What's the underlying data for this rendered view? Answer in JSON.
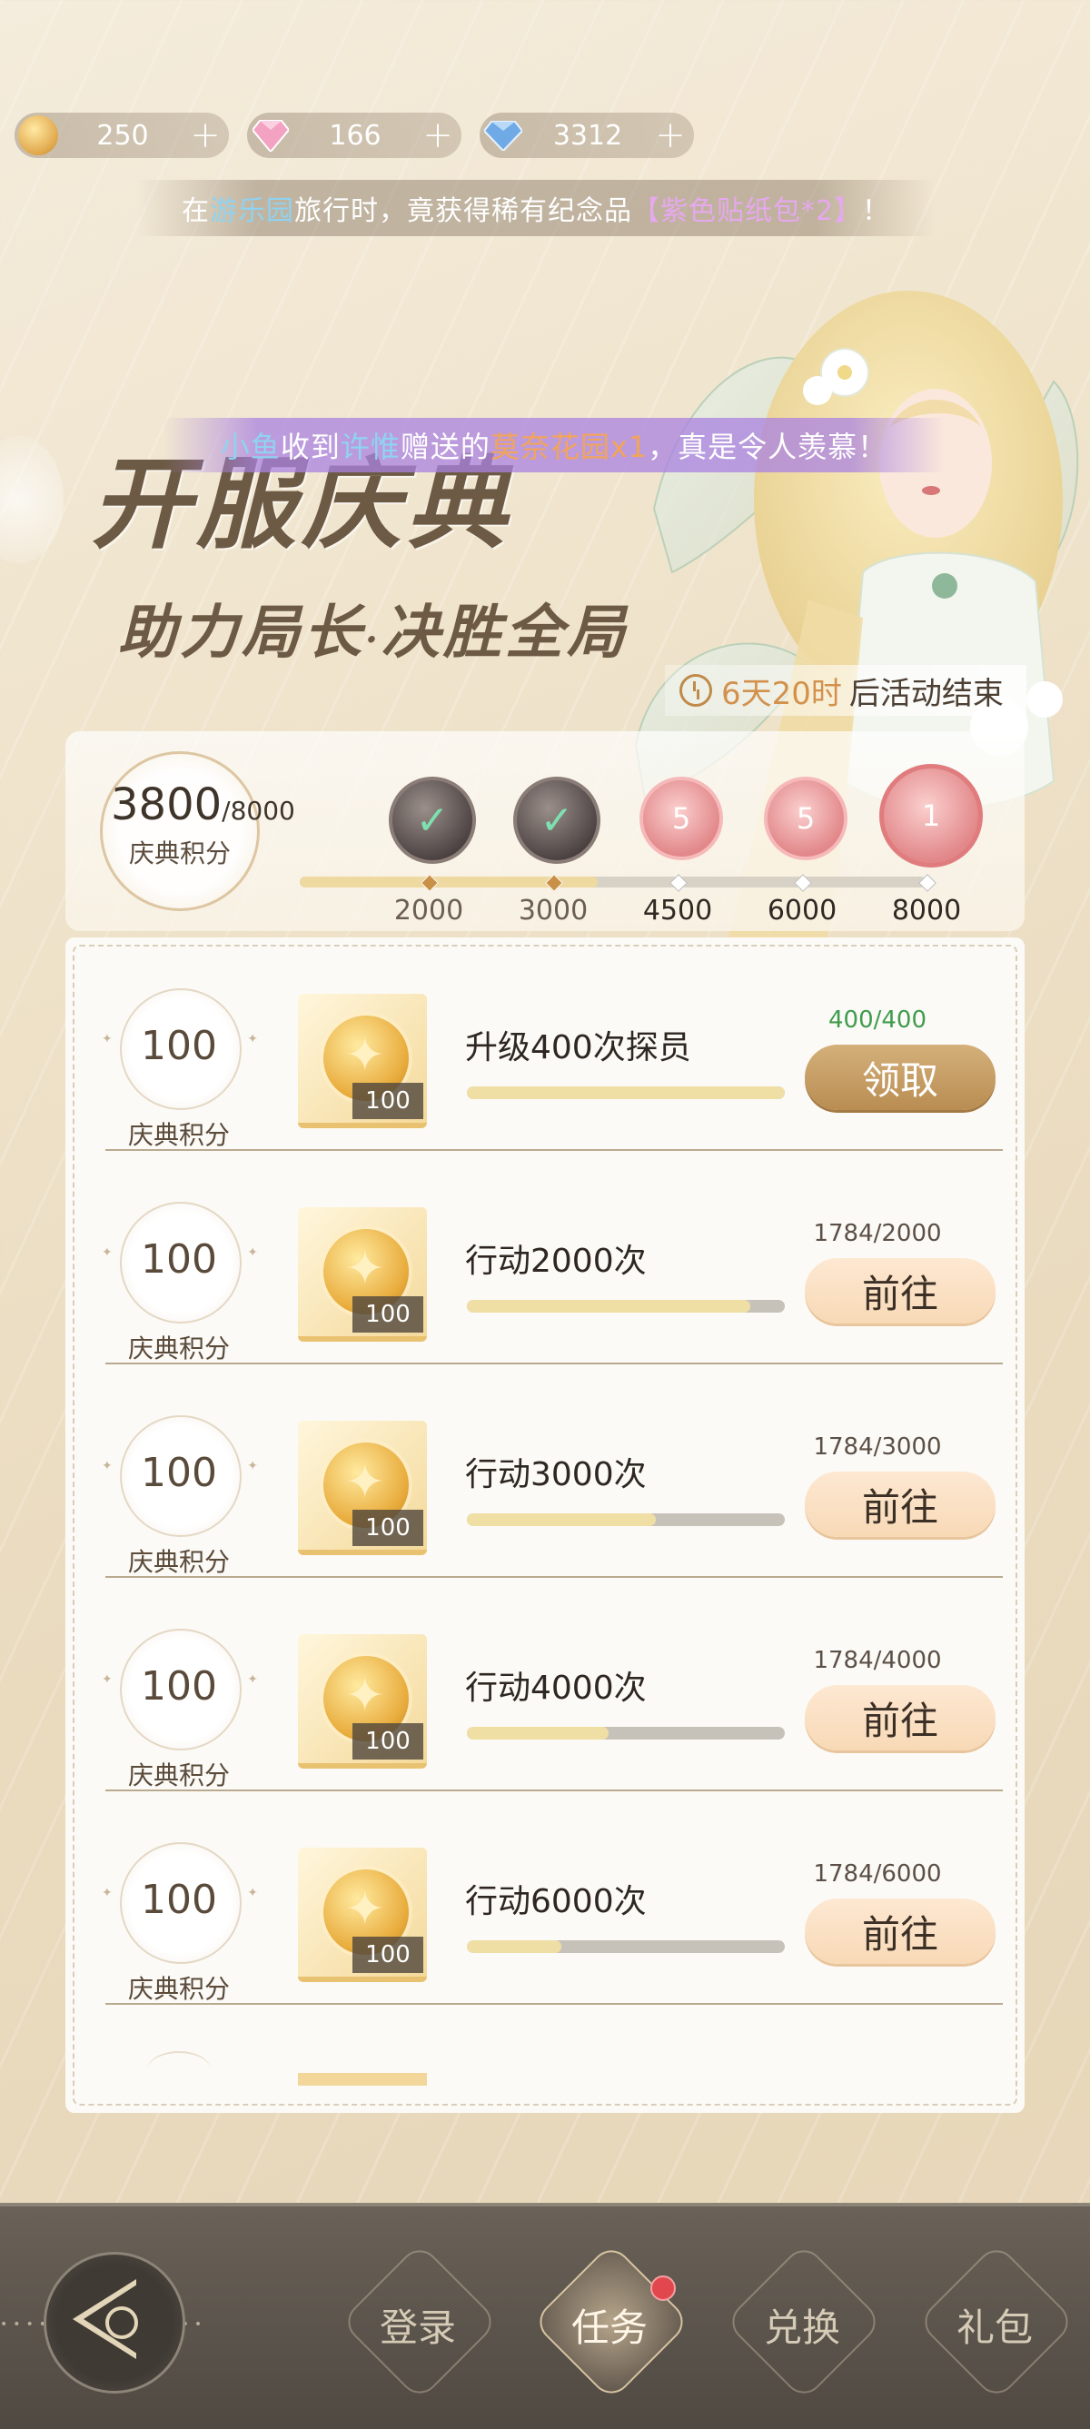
{
  "currencies": [
    {
      "icon": "gold-coin-icon",
      "value": "250",
      "plus": "+"
    },
    {
      "icon": "pink-gem-icon",
      "value": "166",
      "plus": "+"
    },
    {
      "icon": "blue-diamond-icon",
      "value": "3312",
      "plus": "+"
    }
  ],
  "notice": {
    "p1": "在",
    "place": "游乐园",
    "p2": "旅行时，竟获得稀有纪念品",
    "item": "【紫色贴纸包*2】",
    "p3": "！"
  },
  "broadcast": {
    "sender": "小鱼",
    "p1": "收到",
    "giver": "许惟",
    "p2": "赠送的",
    "gift": "莫奈花园x1",
    "p3": "，真是令人羡慕！"
  },
  "title": {
    "main": "开服庆典",
    "sub_a": "助力局长",
    "sub_dot": "·",
    "sub_b": "决胜全局"
  },
  "timer": {
    "time": "6天20时",
    "suffix": "后活动结束"
  },
  "score": {
    "current": "3800",
    "total": "/8000",
    "label": "庆典积分"
  },
  "progress_fraction": 0.475,
  "milestones": [
    {
      "value": "2000",
      "state": "claimed",
      "badge": "✓"
    },
    {
      "value": "3000",
      "state": "claimed",
      "badge": "✓"
    },
    {
      "value": "4500",
      "state": "pending",
      "badge": "5"
    },
    {
      "value": "6000",
      "state": "pending",
      "badge": "5"
    },
    {
      "value": "8000",
      "state": "pending",
      "badge": "1"
    }
  ],
  "tasks": [
    {
      "points": "100",
      "points_label": "庆典积分",
      "item_qty": "100",
      "name": "升级400次探员",
      "done": "400",
      "goal": "/400",
      "progress": 1.0,
      "button": "领取",
      "button_type": "claim"
    },
    {
      "points": "100",
      "points_label": "庆典积分",
      "item_qty": "100",
      "name": "行动2000次",
      "done": "1784",
      "goal": "/2000",
      "progress": 0.892,
      "button": "前往",
      "button_type": "go"
    },
    {
      "points": "100",
      "points_label": "庆典积分",
      "item_qty": "100",
      "name": "行动3000次",
      "done": "1784",
      "goal": "/3000",
      "progress": 0.595,
      "button": "前往",
      "button_type": "go"
    },
    {
      "points": "100",
      "points_label": "庆典积分",
      "item_qty": "100",
      "name": "行动4000次",
      "done": "1784",
      "goal": "/4000",
      "progress": 0.446,
      "button": "前往",
      "button_type": "go"
    },
    {
      "points": "100",
      "points_label": "庆典积分",
      "item_qty": "100",
      "name": "行动6000次",
      "done": "1784",
      "goal": "/6000",
      "progress": 0.297,
      "button": "前往",
      "button_type": "go"
    }
  ],
  "nav": {
    "back_icon": "back-arrow-icon",
    "tabs": [
      {
        "label": "登录",
        "active": false
      },
      {
        "label": "任务",
        "active": true,
        "badge": true
      },
      {
        "label": "兑换",
        "active": false
      },
      {
        "label": "礼包",
        "active": false
      }
    ]
  },
  "colors": {
    "accent": "#c08a4a",
    "notice_blue": "#8fd3f0",
    "notice_purple": "#e6a8ef",
    "gift_orange": "#f2a45b",
    "claim_button": "#c29a62",
    "go_button": "#fbe2c8",
    "badge_red": "#e2474e"
  }
}
